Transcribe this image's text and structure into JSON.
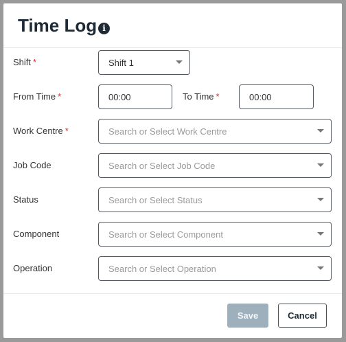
{
  "dialog": {
    "title": "Time Log",
    "info_icon": "info-icon"
  },
  "form": {
    "required_mark": "*",
    "shift": {
      "label": "Shift",
      "value": "Shift 1"
    },
    "from_time": {
      "label": "From Time",
      "value": "00:00"
    },
    "to_time": {
      "label": "To Time",
      "value": "00:00"
    },
    "work_centre": {
      "label": "Work Centre",
      "placeholder": "Search or Select Work Centre"
    },
    "job_code": {
      "label": "Job Code",
      "placeholder": "Search or Select Job Code"
    },
    "status": {
      "label": "Status",
      "placeholder": "Search or Select Status"
    },
    "component": {
      "label": "Component",
      "placeholder": "Search or Select Component"
    },
    "operation": {
      "label": "Operation",
      "placeholder": "Search or Select Operation"
    }
  },
  "footer": {
    "save_label": "Save",
    "cancel_label": "Cancel"
  },
  "colors": {
    "required": "#d32f2f",
    "save_disabled": "#9fb0bd",
    "title": "#1f2a37"
  }
}
